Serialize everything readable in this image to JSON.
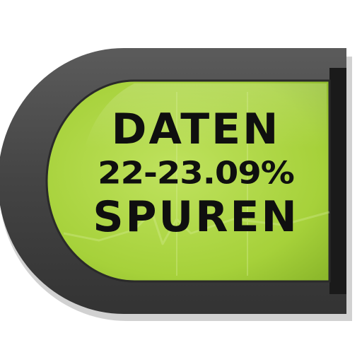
{
  "badge": {
    "line1": "DATEN",
    "line2": "22-23.09%",
    "line3": "SPUREN"
  },
  "colors": {
    "frame": "#3f3f3f",
    "frame_highlight": "#5a5a5a",
    "screen": "#a9d33c",
    "screen_light": "#c2e46a",
    "screen_dark": "#86b02a",
    "text": "#0f0f0f",
    "right_edge": "#1a1a1a"
  },
  "icons": {
    "background_graph": "graph-line-icon"
  }
}
